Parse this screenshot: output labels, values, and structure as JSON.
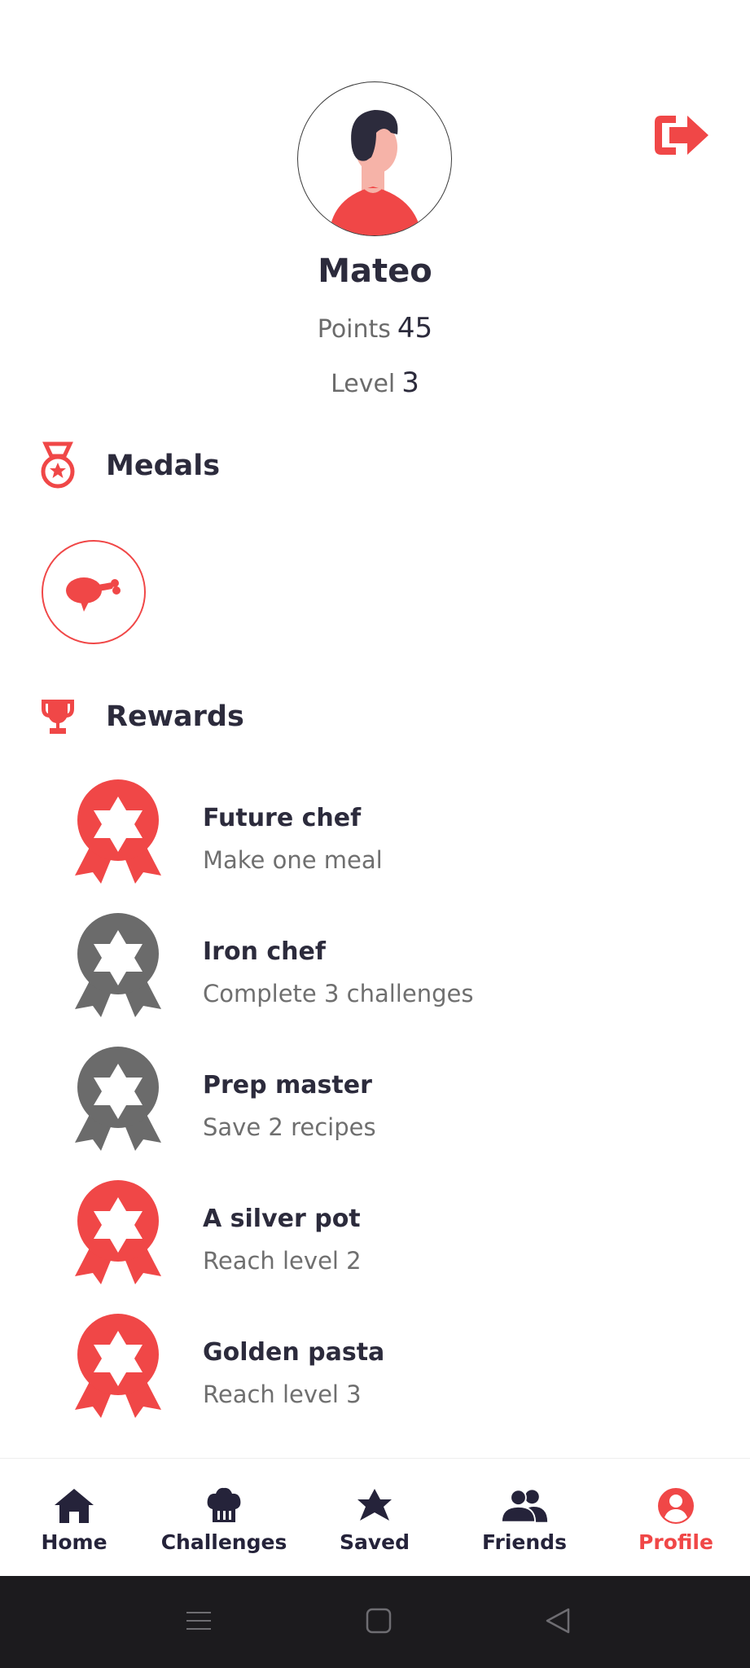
{
  "profile": {
    "name": "Mateo",
    "points_label": "Points",
    "points_value": "45",
    "level_label": "Level",
    "level_value": "3"
  },
  "sections": {
    "medals_title": "Medals",
    "rewards_title": "Rewards"
  },
  "medals": [
    {
      "icon": "chicken-leg-icon"
    }
  ],
  "rewards": [
    {
      "title": "Future chef",
      "description": "Make one meal",
      "earned": true
    },
    {
      "title": "Iron chef",
      "description": "Complete 3 challenges",
      "earned": false
    },
    {
      "title": "Prep master",
      "description": "Save 2 recipes",
      "earned": false
    },
    {
      "title": "A silver pot",
      "description": "Reach level 2",
      "earned": true
    },
    {
      "title": "Golden pasta",
      "description": "Reach level 3",
      "earned": true
    }
  ],
  "nav": {
    "items": [
      {
        "label": "Home",
        "icon": "home-icon"
      },
      {
        "label": "Challenges",
        "icon": "chef-hat-icon"
      },
      {
        "label": "Saved",
        "icon": "star-icon"
      },
      {
        "label": "Friends",
        "icon": "friends-icon"
      },
      {
        "label": "Profile",
        "icon": "profile-icon"
      }
    ],
    "active": "Profile"
  },
  "colors": {
    "accent": "#f04747",
    "locked": "#6b6b6b",
    "text_dark": "#2c2b3c",
    "system_bar": "#1c1b1e"
  }
}
